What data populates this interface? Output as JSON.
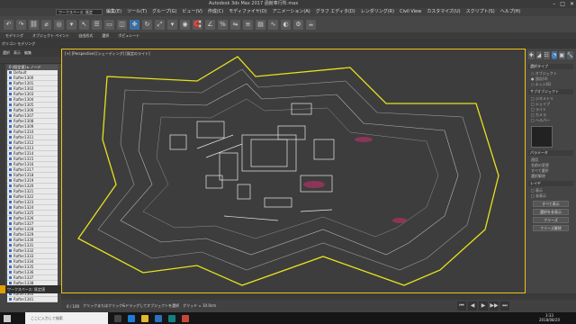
{
  "window": {
    "title": "Autodesk 3ds Max 2017    函館奉行所.max",
    "controls": [
      "–",
      "□",
      "✕"
    ]
  },
  "menubar": {
    "workspace": "ワークスペース: 既定",
    "items": [
      "編集(E)",
      "ツール(T)",
      "グループ(G)",
      "ビュー(V)",
      "作成(C)",
      "モディファイヤ(O)",
      "アニメーション(A)",
      "グラフ エディタ(D)",
      "レンダリング(R)",
      "Civil View",
      "カスタマイズ(U)",
      "スクリプト(S)",
      "ヘルプ(H)"
    ]
  },
  "toolbar": {
    "icons": [
      "undo-icon",
      "redo-icon",
      "link-icon",
      "unlink-icon",
      "bind-icon",
      "selection-filter",
      "select-icon",
      "select-by-name-icon",
      "rect-select-icon",
      "window-crossing-icon",
      "move-icon",
      "rotate-icon",
      "scale-icon",
      "ref-coord",
      "pivot-icon",
      "snap-icon",
      "angle-snap-icon",
      "percent-snap-icon",
      "mirror-icon",
      "align-icon",
      "layer-icon",
      "curve-editor-icon",
      "material-editor-icon",
      "render-setup-icon",
      "render-icon"
    ],
    "glyphs": [
      "↶",
      "↷",
      "⛓",
      "⌀",
      "◎",
      "▾",
      "↖",
      "☰",
      "▭",
      "◫",
      "✥",
      "↻",
      "⤢",
      "▾",
      "◉",
      "🧲",
      "∠",
      "%",
      "⇋",
      "≡",
      "▤",
      "∿",
      "◐",
      "⚙",
      "☕"
    ]
  },
  "ribbon": {
    "tabs": [
      "モデリング",
      "オブジェクト ペイント",
      "自由形式",
      "選択",
      "ポピュレート"
    ],
    "subtitle": "ポリゴン モデリング"
  },
  "explorer": {
    "tabs": [
      "選択",
      "表示",
      "編集"
    ],
    "header": "0 (既定値) ▸ ノード",
    "rows": [
      "Default",
      "Rafter1300",
      "Rafter1301",
      "Rafter1302",
      "Rafter1303",
      "Rafter1304",
      "Rafter1305",
      "Rafter1306",
      "Rafter1307",
      "Rafter1308",
      "Rafter1309",
      "Rafter1310",
      "Rafter1311",
      "Rafter1312",
      "Rafter1313",
      "Rafter1314",
      "Rafter1315",
      "Rafter1316",
      "Rafter1317",
      "Rafter1318",
      "Rafter1319",
      "Rafter1320",
      "Rafter1321",
      "Rafter1322",
      "Rafter1323",
      "Rafter1324",
      "Rafter1325",
      "Rafter1326",
      "Rafter1327",
      "Rafter1328",
      "Rafter1329",
      "Rafter1330",
      "Rafter1331",
      "Rafter1332",
      "Rafter1333",
      "Rafter1334",
      "Rafter1335",
      "Rafter1336",
      "Rafter1337",
      "Rafter1338",
      "Rafter1339",
      "Rafter1340",
      "Rafter1341"
    ],
    "workspace_label": "ワークスペース: 既定値"
  },
  "viewport": {
    "label": "[+] [Perspective] [シェーディング] [既定のライト]"
  },
  "command_panel": {
    "tabs": [
      "✚",
      "◢",
      "☷",
      "◔",
      "▣",
      "🔧"
    ],
    "sections": [
      {
        "title": "選択タイプ",
        "options": [
          "○ オブジェクト",
          "● 頂点(V)",
          "○ エッジ(E)"
        ]
      },
      {
        "title": "サブオブジェクト",
        "options": [
          "□ ジオメトリ",
          "□ シェイプ",
          "□ ライト",
          "□ カメラ",
          "□ ヘルパー"
        ]
      },
      {
        "title": "パラメータ",
        "options": [
          "適用",
          "名前の変更",
          "すべて選択",
          "選択解除"
        ]
      },
      {
        "title": "レイヤ",
        "options": [
          "□ 表示",
          "□ 非表示"
        ]
      }
    ],
    "buttons": [
      "すべて表示",
      "選択を非表示",
      "フリーズ",
      "フリーズ解除"
    ]
  },
  "timeline": {
    "ticks": [
      "0",
      "10",
      "20",
      "30",
      "40",
      "50",
      "60",
      "70",
      "80",
      "90",
      "100"
    ]
  },
  "status": {
    "frame": "0 / 100",
    "message": "クリックまたはクリック&ドラッグしてオブジェクトを選択",
    "grid": "グリッド = 10.0cm",
    "play": [
      "⏮",
      "◀",
      "▶",
      "▶▶",
      "⏭"
    ]
  },
  "taskbar": {
    "search": "ここに入力して検索",
    "apps": [
      {
        "name": "task-view",
        "color": "#444"
      },
      {
        "name": "edge",
        "color": "#1e7bd6"
      },
      {
        "name": "explorer",
        "color": "#e3b72e"
      },
      {
        "name": "store",
        "color": "#2e6fbf"
      },
      {
        "name": "3ds-max",
        "color": "#147f80"
      },
      {
        "name": "chrome",
        "color": "#c7463a"
      }
    ],
    "time": "3:33",
    "date": "2018/08/20"
  },
  "colors": {
    "accent": "#3a6fa5",
    "viewport_border": "#f1c40f",
    "fort_outline": "#e6e21e",
    "highlight": "#c0306a"
  }
}
